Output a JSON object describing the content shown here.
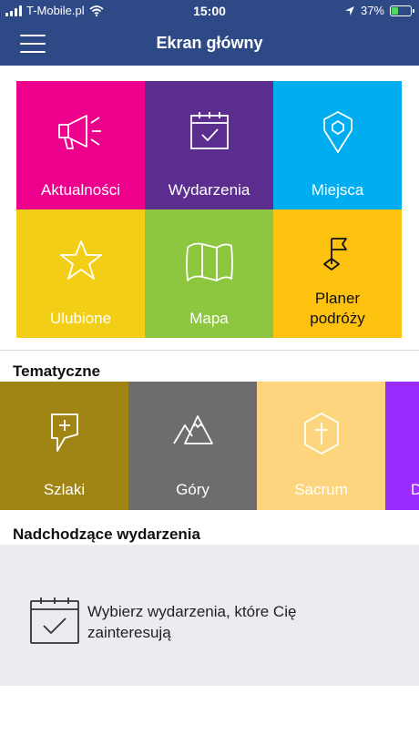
{
  "status": {
    "carrier": "T-Mobile.pl",
    "time": "15:00",
    "battery": "37%",
    "battery_level": 0.37
  },
  "nav": {
    "title": "Ekran główny"
  },
  "colors": {
    "header": "#2e4a86",
    "aktualnosci": "#ec008c",
    "wydarzenia": "#5b2d8e",
    "miejsca": "#00aeef",
    "ulubione": "#f2cf16",
    "mapa": "#8dc63f",
    "planer": "#fdc10f",
    "szlaki": "#a08515",
    "gory": "#6d6d6d",
    "sacrum": "#fcd57e",
    "partial": "#9a2cff"
  },
  "tiles": [
    {
      "label": "Aktualności",
      "icon": "megaphone-icon"
    },
    {
      "label": "Wydarzenia",
      "icon": "calendar-check-icon"
    },
    {
      "label": "Miejsca",
      "icon": "map-pin-icon"
    },
    {
      "label": "Ulubione",
      "icon": "star-icon"
    },
    {
      "label": "Mapa",
      "icon": "folded-map-icon"
    },
    {
      "label": "Planer podróży",
      "icon": "flag-icon"
    }
  ],
  "thematic": {
    "title": "Tematyczne",
    "items": [
      {
        "label": "Szlaki",
        "icon": "sign-plus-icon"
      },
      {
        "label": "Góry",
        "icon": "mountains-icon"
      },
      {
        "label": "Sacrum",
        "icon": "cross-hexagon-icon"
      },
      {
        "label": "D",
        "icon": ""
      }
    ]
  },
  "events": {
    "title": "Nadchodzące wydarzenia",
    "message": "Wybierz wydarzenia, które Cię zainteresują"
  }
}
